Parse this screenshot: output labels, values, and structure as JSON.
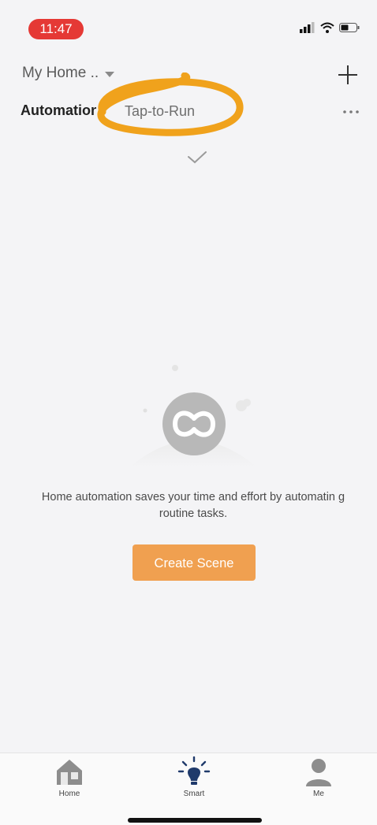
{
  "status_bar": {
    "time": "11:47"
  },
  "header": {
    "home_name": "My Home .."
  },
  "tabs": [
    {
      "label": "Automation"
    },
    {
      "label": "Tap-to-Run"
    }
  ],
  "empty_state": {
    "message": "Home automation saves your time and effort by automatin g routine tasks.",
    "button_label": "Create Scene"
  },
  "tab_bar": [
    {
      "label": "Home",
      "icon": "home-icon"
    },
    {
      "label": "Smart",
      "icon": "lightbulb-icon"
    },
    {
      "label": "Me",
      "icon": "person-icon"
    }
  ],
  "colors": {
    "accent": "#f0a050",
    "status_pill": "#e53935",
    "highlight": "#f0a21c",
    "smart_tab": "#1f3a6b"
  }
}
